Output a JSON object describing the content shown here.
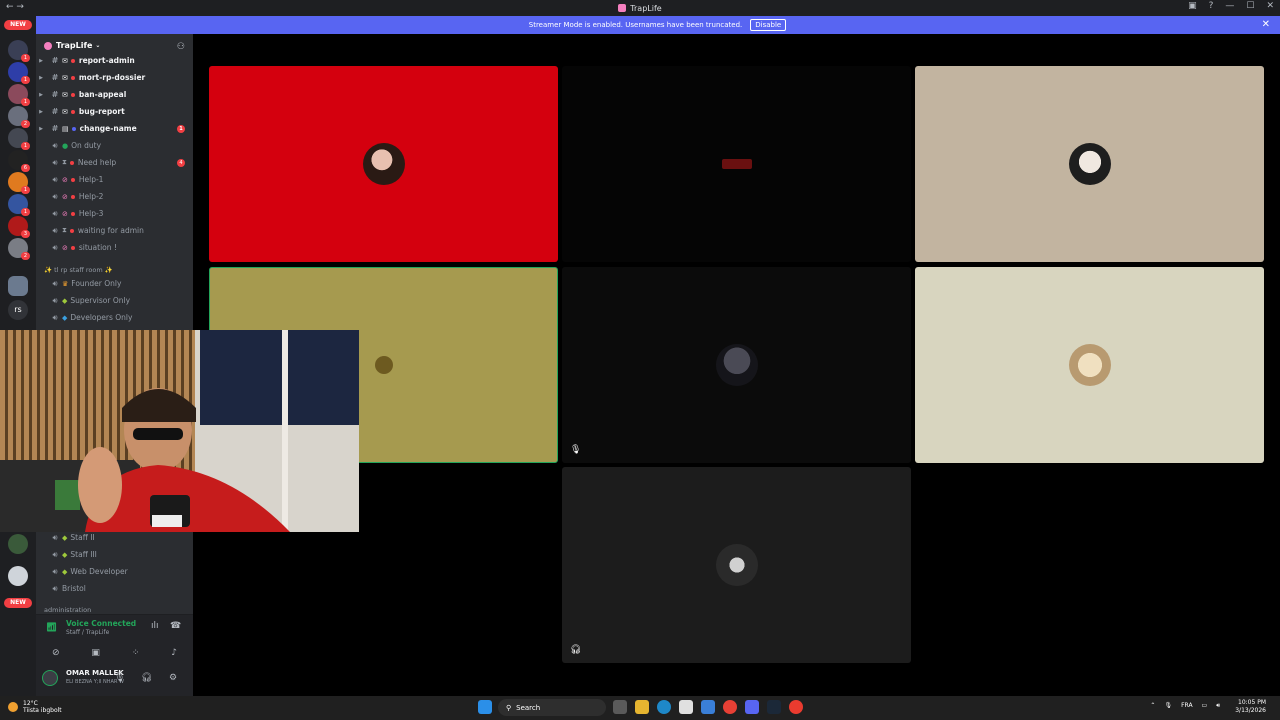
{
  "window": {
    "title": "TrapLife"
  },
  "banner": {
    "text": "Streamer Mode is enabled. Usernames have been truncated.",
    "button": "Disable"
  },
  "servers": {
    "new_top": "NEW",
    "new_bottom": "NEW",
    "rs_label": "rs",
    "badges": [
      "1",
      "1",
      "1",
      "2",
      "1",
      "6",
      "1",
      "1",
      "3",
      "2"
    ]
  },
  "guild": {
    "name": "TrapLife"
  },
  "channels": [
    {
      "label": "report-admin",
      "type": "text",
      "bold": true
    },
    {
      "label": "mort-rp-dossier",
      "type": "text",
      "bold": true
    },
    {
      "label": "ban-appeal",
      "type": "text",
      "bold": true
    },
    {
      "label": "bug-report",
      "type": "text",
      "bold": true
    },
    {
      "label": "change-name",
      "type": "text",
      "bold": true,
      "badge": "1"
    },
    {
      "label": "On duty",
      "type": "voice"
    },
    {
      "label": "Need help",
      "type": "voice",
      "badge": "4"
    },
    {
      "label": "Help-1",
      "type": "voice"
    },
    {
      "label": "Help-2",
      "type": "voice"
    },
    {
      "label": "Help-3",
      "type": "voice"
    },
    {
      "label": "waiting for admin",
      "type": "voice"
    },
    {
      "label": "situation !",
      "type": "voice"
    }
  ],
  "category_staff": "✨ tl rp staff room ✨",
  "staff_channels": [
    {
      "label": "Founder Only"
    },
    {
      "label": "Supervisor Only"
    },
    {
      "label": "Developers Only"
    }
  ],
  "lower_channels": [
    {
      "label": "Staff II"
    },
    {
      "label": "Staff III"
    },
    {
      "label": "Web Developer"
    },
    {
      "label": "Bristol"
    }
  ],
  "category_admin": "administration",
  "voice": {
    "status": "Voice Connected",
    "location": "Staff / TrapLife"
  },
  "user": {
    "name": "OMAR MALLEK",
    "status": "ELI BEZNA Y;II NHAR W"
  },
  "taskbar": {
    "temp": "12°C",
    "weather": "Tiista ibgbolt",
    "search": "Search",
    "lang": "FRA",
    "time": "10:05 PM",
    "date": "3/13/2026"
  },
  "colors": {
    "accent": "#5865f2",
    "online": "#23a55a",
    "danger": "#f23f43",
    "tile_red": "#d4000e",
    "tile_beige": "#c2b4a0",
    "tile_olive": "#a69a4f",
    "tile_cream": "#d8d5bf",
    "tile_dark1": "#050505",
    "tile_dark2": "#0b0b0b",
    "tile_dark3": "#1c1c1c"
  }
}
